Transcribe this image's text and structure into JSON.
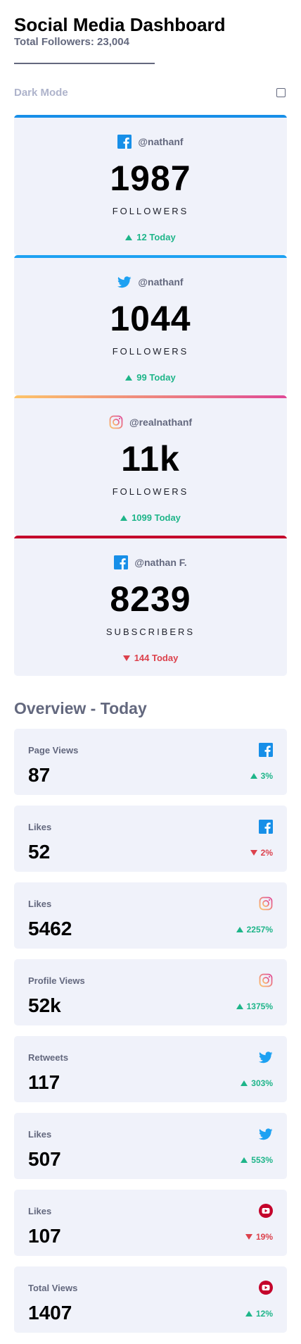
{
  "header": {
    "title": "Social Media Dashboard",
    "subtitle": "Total Followers: 23,004",
    "dark_mode_label": "Dark Mode"
  },
  "colors": {
    "facebook": "#178fe8",
    "twitter": "#1da1f2",
    "instagram_start": "#fdc468",
    "instagram_end": "#df4996",
    "youtube": "#c4032b",
    "up": "#1eb589",
    "down": "#dc414c"
  },
  "cards": [
    {
      "platform": "facebook",
      "icon": "facebook-icon",
      "handle": "@nathanf",
      "count": "1987",
      "unit": "FOLLOWERS",
      "today": "12 Today",
      "trend": "up"
    },
    {
      "platform": "twitter",
      "icon": "twitter-icon",
      "handle": "@nathanf",
      "count": "1044",
      "unit": "FOLLOWERS",
      "today": "99 Today",
      "trend": "up"
    },
    {
      "platform": "instagram",
      "icon": "instagram-icon",
      "handle": "@realnathanf",
      "count": "11k",
      "unit": "FOLLOWERS",
      "today": "1099 Today",
      "trend": "up"
    },
    {
      "platform": "youtube",
      "icon": "facebook-icon",
      "handle": "@nathan F.",
      "count": "8239",
      "unit": "SUBSCRIBERS",
      "today": "144 Today",
      "trend": "down"
    }
  ],
  "overview": {
    "title": "Overview - Today",
    "items": [
      {
        "label": "Page Views",
        "value": "87",
        "pct": "3%",
        "trend": "up",
        "icon": "facebook-icon"
      },
      {
        "label": "Likes",
        "value": "52",
        "pct": "2%",
        "trend": "down",
        "icon": "facebook-icon"
      },
      {
        "label": "Likes",
        "value": "5462",
        "pct": "2257%",
        "trend": "up",
        "icon": "instagram-icon"
      },
      {
        "label": "Profile Views",
        "value": "52k",
        "pct": "1375%",
        "trend": "up",
        "icon": "instagram-icon"
      },
      {
        "label": "Retweets",
        "value": "117",
        "pct": "303%",
        "trend": "up",
        "icon": "twitter-icon"
      },
      {
        "label": "Likes",
        "value": "507",
        "pct": "553%",
        "trend": "up",
        "icon": "twitter-icon"
      },
      {
        "label": "Likes",
        "value": "107",
        "pct": "19%",
        "trend": "down",
        "icon": "youtube-icon"
      },
      {
        "label": "Total Views",
        "value": "1407",
        "pct": "12%",
        "trend": "up",
        "icon": "youtube-icon"
      }
    ]
  }
}
